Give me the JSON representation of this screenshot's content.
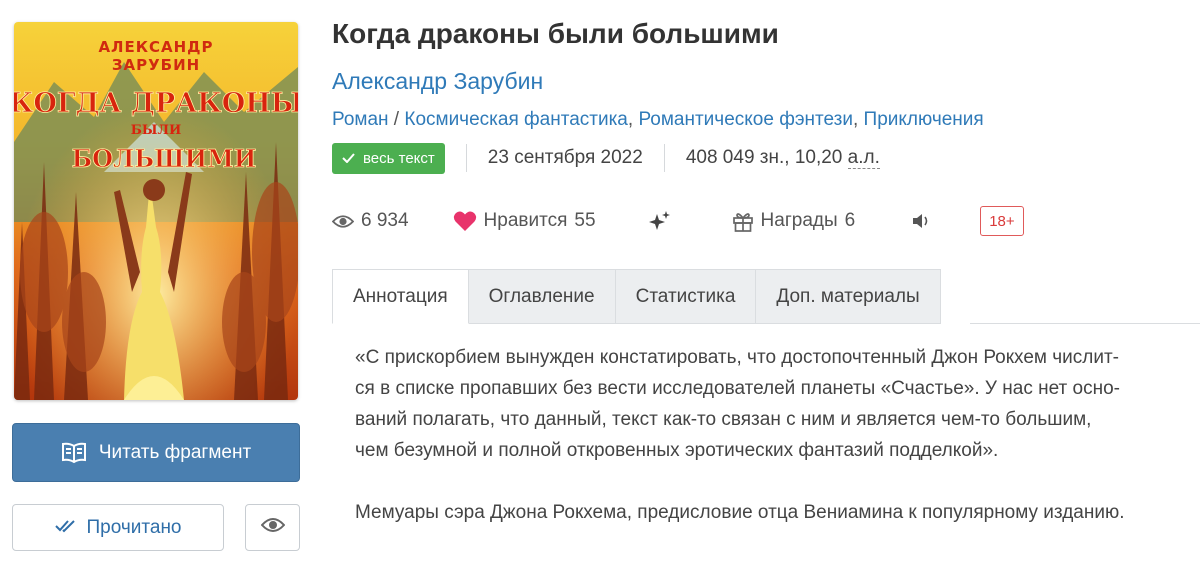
{
  "book": {
    "title": "Когда драконы были большими",
    "author": "Александр Зарубин",
    "genre_primary": "Роман",
    "genre_sep": " / ",
    "genres": [
      "Космическая фантастика",
      "Романтическое фэнтези",
      "Приключения"
    ],
    "status_badge": "весь текст",
    "date": "23 сентября 2022",
    "size_text": "408 049 зн., 10,20 ",
    "size_unit": "а.л.",
    "cover": {
      "author_line1": "АЛЕКСАНДР",
      "author_line2": "ЗАРУБИН",
      "title_line1": "КОГДА ДРАКОНЫ",
      "title_line2": "БЫЛИ",
      "title_line3": "БОЛЬШИМИ"
    }
  },
  "stats": {
    "views": "6 934",
    "likes_label": "Нравится",
    "likes": "55",
    "awards_label": "Награды",
    "awards": "6",
    "age_rating": "18+"
  },
  "actions": {
    "read_fragment": "Читать фрагмент",
    "mark_read": "Прочитано"
  },
  "tabs": [
    {
      "label": "Аннотация",
      "active": true
    },
    {
      "label": "Оглавление",
      "active": false
    },
    {
      "label": "Статистика",
      "active": false
    },
    {
      "label": "Доп. материалы",
      "active": false
    }
  ],
  "annotation": {
    "paragraph1_lines": [
      "«С прискорбием вынужден констатировать, что достопочтенный Джон Рокхем числит-",
      "ся в списке пропавших без вести исследователей планеты «Счастье». У нас нет осно-",
      "ваний полагать, что данный, текст как-то связан с ним и является чем-то большим,",
      "чем безумной и полной откровенных эротических фантазий подделкой»."
    ],
    "paragraph2": "Мемуары сэра Джона Рокхема, предисловие отца Вениамина к популярному изданию."
  },
  "colors": {
    "link": "#2f7ab8",
    "primary_button": "#4a7fb0",
    "badge_green": "#4caf50",
    "heart": "#e8336b",
    "age_red": "#d93a3a"
  }
}
